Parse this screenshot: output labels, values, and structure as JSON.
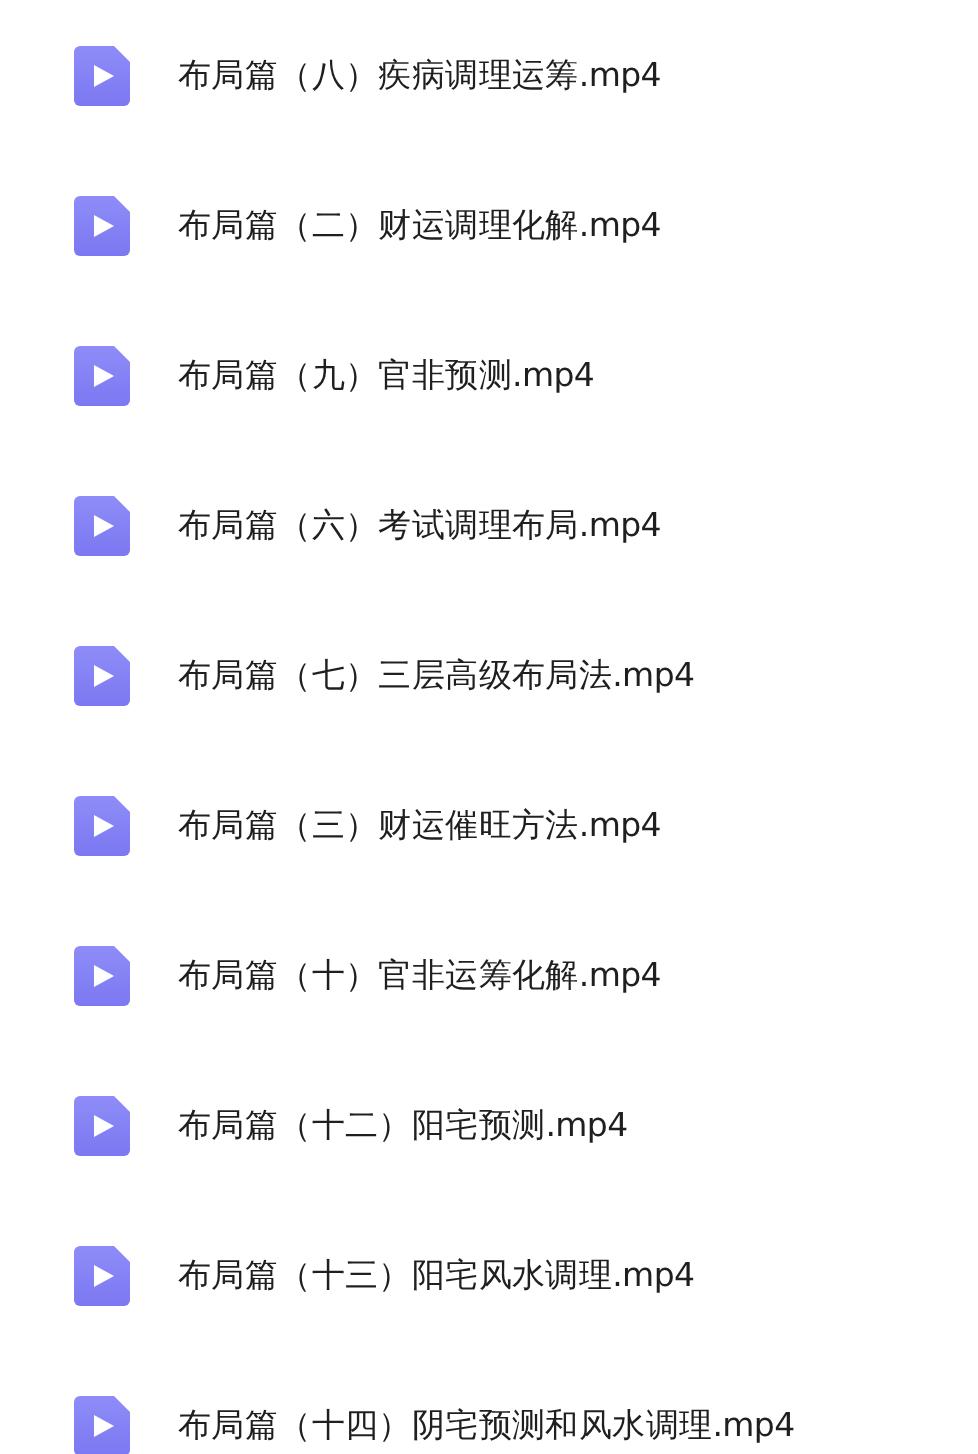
{
  "files": [
    {
      "name": "布局篇（八）疾病调理运筹.mp4"
    },
    {
      "name": "布局篇（二）财运调理化解.mp4"
    },
    {
      "name": "布局篇（九）官非预测.mp4"
    },
    {
      "name": "布局篇（六）考试调理布局.mp4"
    },
    {
      "name": "布局篇（七）三层高级布局法.mp4"
    },
    {
      "name": "布局篇（三）财运催旺方法.mp4"
    },
    {
      "name": "布局篇（十）官非运筹化解.mp4"
    },
    {
      "name": "布局篇（十二）阳宅预测.mp4"
    },
    {
      "name": "布局篇（十三）阳宅风水调理.mp4"
    },
    {
      "name": "布局篇（十四）阴宅预测和风水调理.mp4"
    }
  ]
}
